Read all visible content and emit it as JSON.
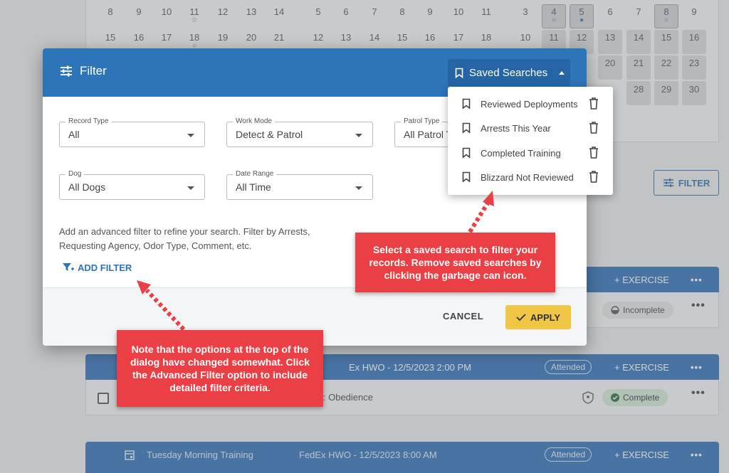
{
  "background": {
    "calendar": {
      "row1": [
        "8",
        "9",
        "10",
        "11",
        "12",
        "13",
        "14",
        "5",
        "6",
        "7",
        "8",
        "9",
        "10",
        "11",
        "3",
        "4",
        "5",
        "6",
        "7",
        "8",
        "9"
      ],
      "row2": [
        "15",
        "16",
        "17",
        "18",
        "19",
        "20",
        "21",
        "12",
        "13",
        "14",
        "15",
        "16",
        "17",
        "18",
        "10",
        "11",
        "12",
        "13",
        "14",
        "15",
        "16"
      ],
      "row3": [
        "20",
        "21",
        "22",
        "23"
      ],
      "row4": [
        "28",
        "29",
        "30"
      ]
    },
    "filter_button_label": "FILTER",
    "cards": [
      {
        "exercise": "+ EXERCISE",
        "status": "Incomplete"
      },
      {
        "title_fragment": "Ex HWO - 12/5/2023 2:00 PM",
        "badge": "Attended",
        "exercise": "+ EXERCISE",
        "body_fragment": "l: Obedience",
        "status": "Complete"
      },
      {
        "title": "Tuesday Morning Training",
        "subtitle": "FedEx HWO - 12/5/2023 8:00 AM",
        "badge": "Attended",
        "exercise": "+ EXERCISE"
      }
    ],
    "colors": {
      "card_header": "#2e6fb7",
      "complete_pill": "#cfe8d6",
      "incomplete_pill": "#e2e3e5"
    }
  },
  "dialog": {
    "title": "Filter",
    "saved_searches_label": "Saved Searches",
    "fields": [
      {
        "label": "Record Type",
        "value": "All"
      },
      {
        "label": "Work Mode",
        "value": "Detect & Patrol"
      },
      {
        "label": "Patrol Type",
        "value": "All Patrol T"
      },
      {
        "label": "Dog",
        "value": "All Dogs"
      },
      {
        "label": "Date Range",
        "value": "All Time"
      }
    ],
    "help_text": "Add an advanced filter to refine your search. Filter by Arrests, Requesting Agency, Odor Type, Comment, etc.",
    "add_filter_label": "ADD FILTER",
    "cancel_label": "CANCEL",
    "apply_label": "APPLY",
    "colors": {
      "header": "#2e74b9",
      "apply": "#f1c644"
    }
  },
  "saved_searches": [
    {
      "label": "Reviewed Deployments"
    },
    {
      "label": "Arrests This Year"
    },
    {
      "label": "Completed Training"
    },
    {
      "label": "Blizzard Not Reviewed"
    }
  ],
  "callouts": {
    "saved_search_tip": "Select a saved search to filter your records. Remove saved searches by clicking the garbage can icon.",
    "advanced_filter_tip": "Note that the options at the top of the dialog have changed somewhat. Click the Advanced Filter option to include detailed filter criteria.",
    "color": "#ea3f44"
  }
}
